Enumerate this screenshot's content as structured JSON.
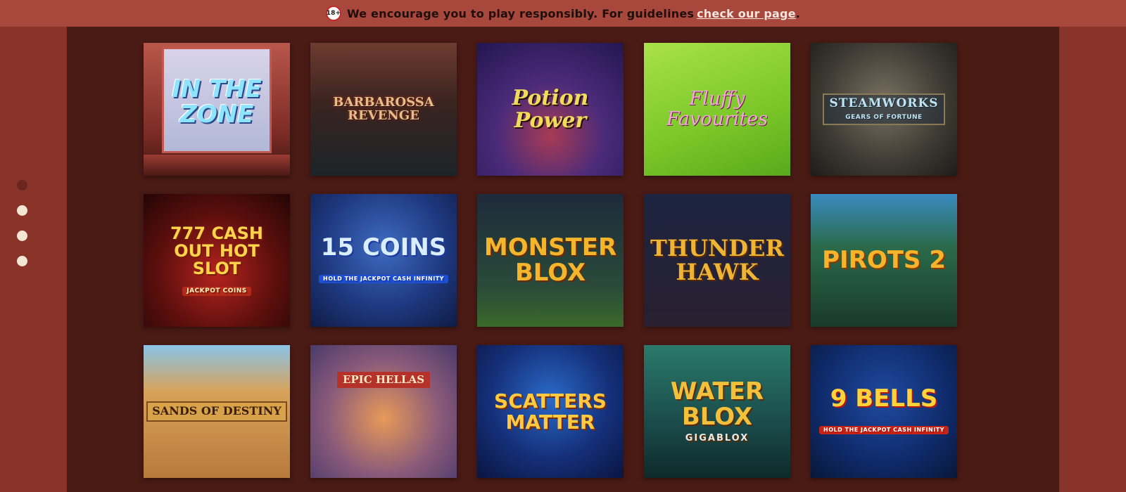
{
  "banner": {
    "age_badge": "18+",
    "text": "We encourage you to play responsibly. For guidelines",
    "link_text": "check our page",
    "trailing": "."
  },
  "carousel": {
    "dots": 4,
    "active_index": 0
  },
  "games": [
    {
      "title": "In The Zone",
      "sub": ""
    },
    {
      "title": "Barbarossa Revenge",
      "sub": ""
    },
    {
      "title": "Potion Power",
      "sub": ""
    },
    {
      "title": "Fluffy Favourites",
      "sub": ""
    },
    {
      "title": "Steamworks",
      "sub": "Gears of Fortune"
    },
    {
      "title": "777 Cash Out Hot Slot",
      "sub": "Jackpot Coins"
    },
    {
      "title": "15 Coins",
      "sub": "Hold the Jackpot Cash Infinity"
    },
    {
      "title": "Monster Blox",
      "sub": ""
    },
    {
      "title": "Thunder Hawk",
      "sub": ""
    },
    {
      "title": "Pirots 2",
      "sub": ""
    },
    {
      "title": "Sands of Destiny",
      "sub": ""
    },
    {
      "title": "Epic Hellas",
      "sub": ""
    },
    {
      "title": "Scatters Matter",
      "sub": ""
    },
    {
      "title": "Water Blox",
      "sub": "Gigablox"
    },
    {
      "title": "9 Bells",
      "sub": "Hold the Jackpot Cash Infinity"
    }
  ],
  "colors": {
    "banner_bg": "#a8473b",
    "page_bg": "#8a3328",
    "content_bg": "#4a1a15",
    "dot_inactive": "#f4e6d3",
    "dot_active": "#6a2520"
  }
}
